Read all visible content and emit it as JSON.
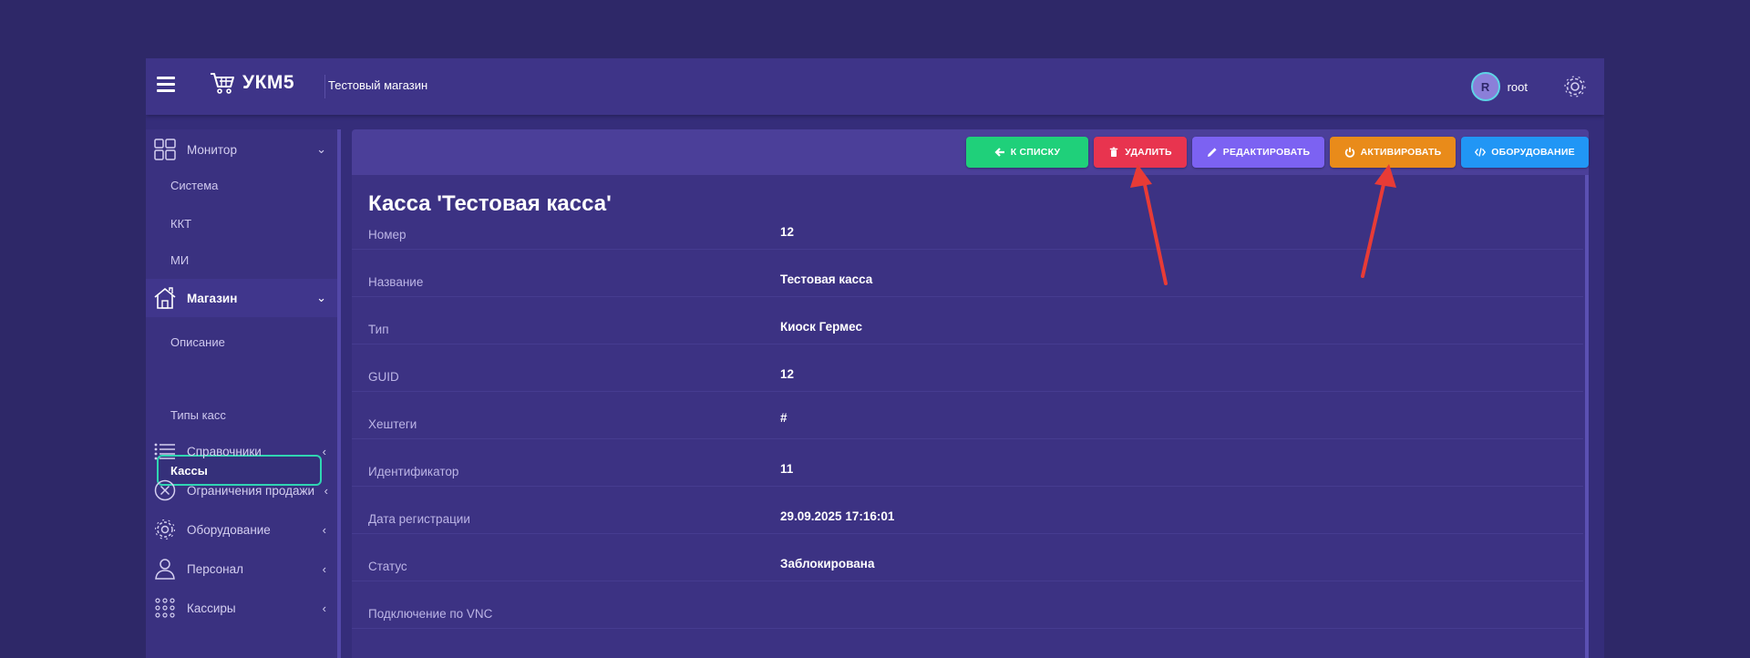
{
  "header": {
    "logo_text": "УКМ5",
    "shop_name": "Тестовый магазин",
    "user_initial": "R",
    "user_name": "root"
  },
  "sidebar": {
    "monitor": {
      "label": "Монитор",
      "chevron": "⌄"
    },
    "monitor_items": [
      "Система",
      "ККТ",
      "МИ"
    ],
    "shop": {
      "label": "Магазин",
      "chevron": "⌄"
    },
    "shop_items": [
      "Описание",
      "Кассы",
      "Типы касс"
    ],
    "items": [
      {
        "label": "Справочники",
        "icon": "list-icon"
      },
      {
        "label": "Ограничения продажи",
        "icon": "circle-x-icon"
      },
      {
        "label": "Оборудование",
        "icon": "gear-icon"
      },
      {
        "label": "Персонал",
        "icon": "person-icon"
      },
      {
        "label": "Кассиры",
        "icon": "grid-dots-icon"
      }
    ],
    "collapsed_chevron": "‹"
  },
  "toolbar": {
    "list": "К СПИСКУ",
    "delete": "УДАЛИТЬ",
    "edit": "РЕДАКТИРОВАТЬ",
    "activate": "АКТИВИРОВАТЬ",
    "equipment": "ОБОРУДОВАНИЕ"
  },
  "colors": {
    "list_btn": "#1fd07a",
    "delete_btn": "#e8344f",
    "edit_btn": "#7c62f2",
    "activate_btn": "#e98b1a",
    "equipment_btn": "#2196f5",
    "active_border": "#30d5b2",
    "arrow": "#e83b36"
  },
  "page": {
    "title": "Касса 'Тестовая касса'"
  },
  "details": [
    {
      "label": "Номер",
      "value": "12"
    },
    {
      "label": "Название",
      "value": "Тестовая касса"
    },
    {
      "label": "Тип",
      "value": "Киоск Гермес"
    },
    {
      "label": "GUID",
      "value": "12"
    },
    {
      "label": "Хештеги",
      "value": "#"
    },
    {
      "label": "Идентификатор",
      "value": "11"
    },
    {
      "label": "Дата регистрации",
      "value": "29.09.2025 17:16:01"
    },
    {
      "label": "Статус",
      "value": "Заблокирована"
    },
    {
      "label": "Подключение по VNC",
      "value": ""
    }
  ]
}
